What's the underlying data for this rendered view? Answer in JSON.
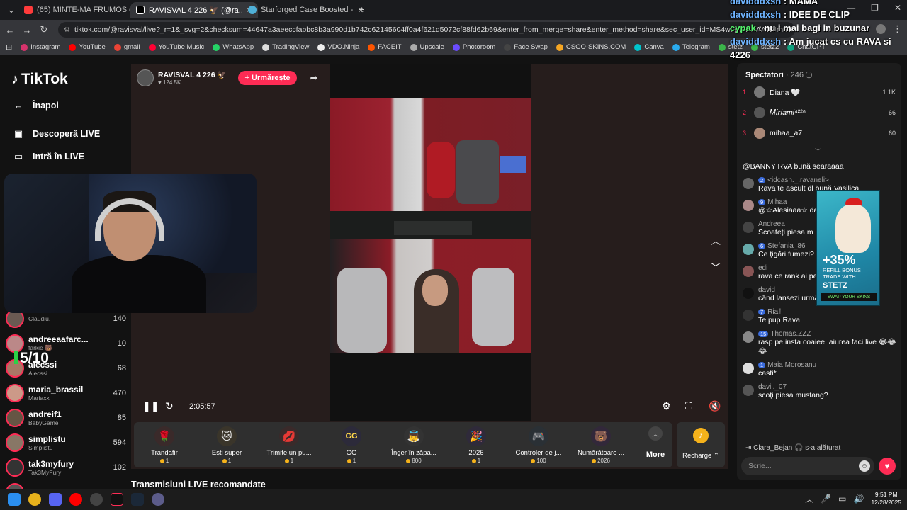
{
  "browser": {
    "tabs": [
      {
        "title": "(65) MINTE-MA FRUMOS cu Er...",
        "color": "#ff3b3b"
      },
      {
        "title": "RAVISVAL 4 226 🦅 (@ra...",
        "color": "#ffffff"
      },
      {
        "title": "Starforged Case Boosted - CSG...",
        "color": "#4fb0d8"
      }
    ],
    "new_tab": "+",
    "url": "tiktok.com/@ravisval/live?_r=1&_svg=2&checksum=44647a3aeeccfabbc8b3a990d1b742c62145604ff0a4f621d5072cf88fd62b69&enter_from_merge=share&enter_method=share&sec_user_id=MS4wLjABAAAAWJrh5CF-qmvfXaw0...",
    "bookmarks": [
      "Instagram",
      "YouTube",
      "gmail",
      "YouTube Music",
      "WhatsApp",
      "TradingView",
      "VDO.Ninja",
      "FACEIT",
      "Upscale",
      "Photoroom",
      "Face Swap",
      "CSGO-SKINS.COM",
      "Canva",
      "Telegram",
      "stetz",
      "stetz2",
      "ChatGPT"
    ]
  },
  "sidebar": {
    "logo": "TikTok",
    "back": "Înapoi",
    "discover": "Descoperă LIVE",
    "go_live": "Intră în LIVE",
    "score": "5/10",
    "following": [
      {
        "name": "",
        "sub": "Claudiu.",
        "count": "140"
      },
      {
        "name": "andreeaafarc...",
        "sub": "farkie 🐻",
        "count": "10"
      },
      {
        "name": "alecssi",
        "sub": "Alecssi",
        "count": "68"
      },
      {
        "name": "maria_brassil",
        "sub": "Mariaxx",
        "count": "470"
      },
      {
        "name": "andreif1",
        "sub": "BabyGame",
        "count": "85"
      },
      {
        "name": "simplistu",
        "sub": "Simplistu",
        "count": "594"
      },
      {
        "name": "tak3myfury",
        "sub": "Tak3MyFury",
        "count": "102"
      },
      {
        "name": "kopeytb",
        "sub": "",
        "count": ""
      }
    ]
  },
  "player": {
    "host_name": "RAVISVAL 4 226 🦅",
    "host_likes": "♥ 124.5K",
    "follow": "+ Urmărește",
    "time": "2:05:57"
  },
  "gifts": [
    {
      "name": "Trandafir",
      "price": "1",
      "icon": "🌹",
      "bg": "#3a2a2a"
    },
    {
      "name": "Ești super",
      "price": "1",
      "icon": "🐱",
      "bg": "#3a352a"
    },
    {
      "name": "Trimite un pu...",
      "price": "1",
      "icon": "💋",
      "bg": "#3a2a2a"
    },
    {
      "name": "GG",
      "price": "1",
      "icon": "GG",
      "bg": "#2c2a3a"
    },
    {
      "name": "Înger în zăpa...",
      "price": "800",
      "icon": "👼",
      "bg": "#333"
    },
    {
      "name": "2026",
      "price": "1",
      "icon": "🎉",
      "bg": "#2f2a3a"
    },
    {
      "name": "Controler de j...",
      "price": "100",
      "icon": "🎮",
      "bg": "#2a3035"
    },
    {
      "name": "Numărătoare ...",
      "price": "2026",
      "icon": "🐻",
      "bg": "#32283a"
    }
  ],
  "more_label": "More",
  "recharge_label": "Recharge ⌃",
  "recommended": "Transmisiuni LIVE recomandate",
  "right_panel": {
    "spectators_title": "Spectatori",
    "spectators_count": "· 246",
    "top": [
      {
        "rank": "1",
        "name": "Diana 🤍",
        "score": "1.1K"
      },
      {
        "rank": "2",
        "name": "𝑀𝑖𝑟𝑖𝑎𝑚𝑖⁴²²⁶",
        "score": "66"
      },
      {
        "rank": "3",
        "name": "mihaa_a7",
        "score": "60"
      }
    ],
    "messages": [
      {
        "user": "",
        "badge": "",
        "text": "@BANNY RVA bună searaaaa"
      },
      {
        "user": "<idcash._.ravaneli>",
        "badge": "2",
        "text": "Rava te ascult dl bună Vasilica"
      },
      {
        "user": "Mihaa",
        "badge": "9",
        "text": "@☆Alesiaaa☆ da"
      },
      {
        "user": "Andreea",
        "badge": "",
        "text": "Scoateți piesa m"
      },
      {
        "user": "Ștefania_86",
        "badge": "6",
        "text": "Ce țigări fumezi?"
      },
      {
        "user": "edi",
        "badge": "",
        "text": "rava ce rank ai pe"
      },
      {
        "user": "david",
        "badge": "",
        "text": "când lansezi următoarea piesa?"
      },
      {
        "user": "Ria†",
        "badge": "7",
        "text": "Te pup Rava"
      },
      {
        "user": "Thomas.ZZZ",
        "badge": "15",
        "text": "rasp pe insta coaiee, aiurea faci live 😂😂😂"
      },
      {
        "user": "Maia Morosanu",
        "badge": "1",
        "text": "casti*"
      },
      {
        "user": "davil._07",
        "badge": "",
        "text": "scoți piesa mustang?"
      }
    ],
    "joined": "Clara_Bejan 🎧  s-a alăturat",
    "input_placeholder": "Scrie..."
  },
  "ad": {
    "percent": "+35%",
    "sub": "REFILL BONUS TRADE WITH",
    "brand": "STETZ",
    "cta": "SWAP YOUR SKINS"
  },
  "overlay": [
    {
      "user": "davidddxsh",
      "text": " : MAMA",
      "green": false
    },
    {
      "user": "davidddxsh",
      "text": " : IDEE DE CLIP",
      "green": false
    },
    {
      "user": "cypak",
      "text": " : nu i mai bagi in buzunar",
      "green": true
    },
    {
      "user": "davidddxsh",
      "text": " : Am jucat cs cu RAVA si",
      "green": false
    },
    {
      "user": "",
      "text": "4226",
      "green": false
    }
  ],
  "taskbar": {
    "time": "9:51 PM",
    "date": "12/28/2025"
  }
}
